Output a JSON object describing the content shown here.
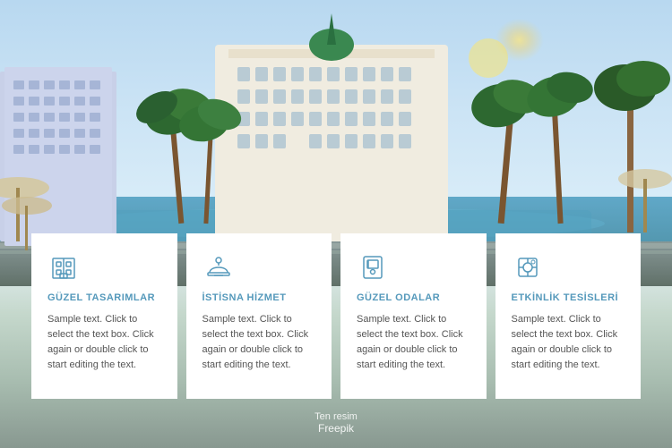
{
  "background": {
    "alt": "Hotel resort with pool"
  },
  "footer": {
    "line1": "Ten resim",
    "line2": "Freepik"
  },
  "cards": [
    {
      "id": "card-1",
      "icon": "hotel-building-icon",
      "title": "GÜZEL TASARIMLAR",
      "text": "Sample text. Click to select the text box. Click again or double click to start editing the text."
    },
    {
      "id": "card-2",
      "icon": "service-bell-icon",
      "title": "İSTİSNA HİZMET",
      "text": "Sample text. Click to select the text box. Click again or double click to start editing the text."
    },
    {
      "id": "card-3",
      "icon": "room-key-icon",
      "title": "GÜZEL ODALAR",
      "text": "Sample text. Click to select the text box. Click again or double click to start editing the text."
    },
    {
      "id": "card-4",
      "icon": "facilities-icon",
      "title": "ETKİNLİK TESİSLERİ",
      "text": "Sample text. Click to select the text box. Click again or double click to start editing the text."
    }
  ]
}
